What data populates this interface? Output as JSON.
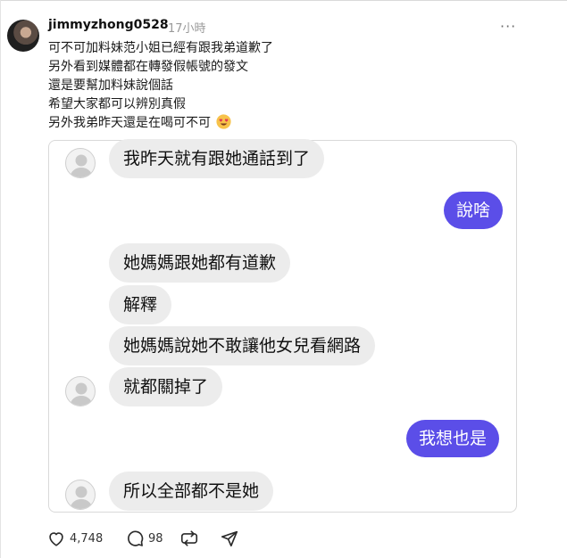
{
  "post": {
    "username": "jimmyzhong0528",
    "time": "17小時",
    "more_label": "···",
    "lines": [
      "可不可加料妹范小姐已經有跟我弟道歉了",
      "另外看到媒體都在轉發假帳號的發文",
      "還是要幫加料妹說個話",
      "希望大家都可以辨別真假",
      "另外我弟昨天還是在喝可不可"
    ],
    "emoji": "heart-eyes-emoji"
  },
  "chat": {
    "messages": [
      {
        "side": "in",
        "text": "我昨天就有跟她通話到了"
      },
      {
        "side": "out",
        "text": "說啥"
      },
      {
        "side": "in",
        "text": "她媽媽跟她都有道歉"
      },
      {
        "side": "in",
        "text": "解釋"
      },
      {
        "side": "in",
        "text": "她媽媽說她不敢讓他女兒看網路"
      },
      {
        "side": "in",
        "text": "就都關掉了"
      },
      {
        "side": "out",
        "text": "我想也是"
      },
      {
        "side": "in",
        "text": "所以全部都不是她"
      }
    ]
  },
  "actions": {
    "likes": "4,748",
    "comments": "98",
    "icons": [
      "heart-icon",
      "comment-icon",
      "repost-icon",
      "share-icon"
    ]
  },
  "colors": {
    "accent": "#5b4ee8",
    "incoming_bubble": "#ececec",
    "muted_text": "#9a9a9a"
  }
}
